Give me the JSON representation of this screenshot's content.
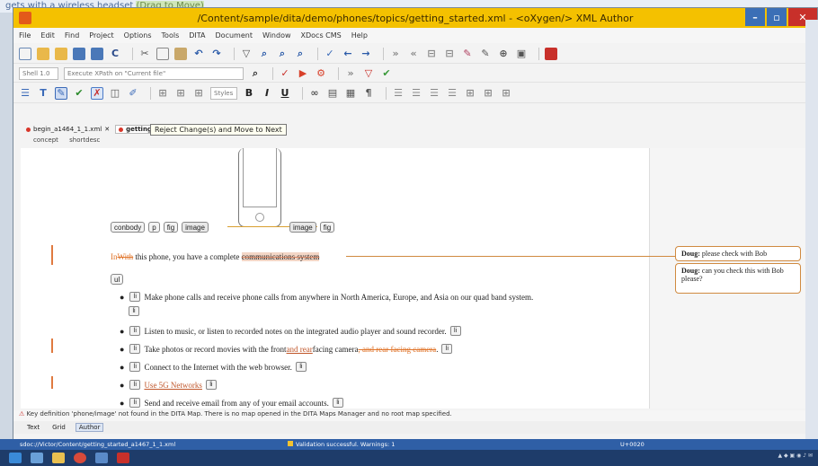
{
  "title": "/Content/sample/dita/demo/phones/topics/getting_started.xml - <oXygen/> XML Author",
  "behind_text": {
    "before": "gets with a wireless headset",
    "highlight": "(Drag to Move)"
  },
  "menu": [
    "File",
    "Edit",
    "Find",
    "Project",
    "Options",
    "Tools",
    "DITA",
    "Document",
    "Window",
    "XDocs CMS",
    "Help"
  ],
  "toolbar2": {
    "combo1": "Shell 1.0",
    "combo2": "Execute XPath on \"Current file\""
  },
  "tabs": [
    "begin_a1464_1_1.xml",
    "getting"
  ],
  "tooltip": "Reject Change(s) and Move to Next",
  "crumbs": [
    "concept",
    "shortdesc"
  ],
  "tags_row": {
    "t1": "conbody",
    "t2": "p",
    "t3": "fig",
    "t4": "image",
    "t5": "image",
    "t6": "fig"
  },
  "paragraph": {
    "ins": "In",
    "plain1": "With",
    "text": " this phone, you have a complete ",
    "cm": "communications system"
  },
  "ul_tag": "ul",
  "list": [
    {
      "text": "Make phone calls and receive phone calls from anywhere in North America, Europe, and Asia on our quad band system.",
      "tag": "li"
    },
    {
      "text": "Listen to music, or listen to recorded notes on the integrated audio player and sound recorder.",
      "tag": "li"
    },
    {
      "pre": "Take photos or record movies with the front ",
      "ins": "and rear",
      "mid": " facing camera",
      "del": ", and rear facing camera",
      "post": ".",
      "tag": "li"
    },
    {
      "text": "Connect to the Internet with the web browser.",
      "tag": "li"
    },
    {
      "link": "Use 5G Networks",
      "tag": "li"
    },
    {
      "text": "Send and receive email from any of your email accounts.",
      "tag": "li"
    }
  ],
  "comments": [
    {
      "author": "Doug:",
      "text": "please check with Bob"
    },
    {
      "author": "Doug:",
      "text": "can you check this with Bob please?"
    }
  ],
  "message": "Key definition 'phone/image' not found in the DITA Map. There is no map opened in the DITA Maps Manager and no root map specified.",
  "modes": [
    "Text",
    "Grid",
    "Author"
  ],
  "status": {
    "path": "sdoc://Victor/Content/getting_started_a1467_1_1.xml",
    "validation": "Validation successful. Warnings: 1",
    "pos": "U+0020"
  },
  "colors": {
    "title": "#f4c100",
    "status": "#2f5fa6",
    "accent": "#e0742a"
  }
}
